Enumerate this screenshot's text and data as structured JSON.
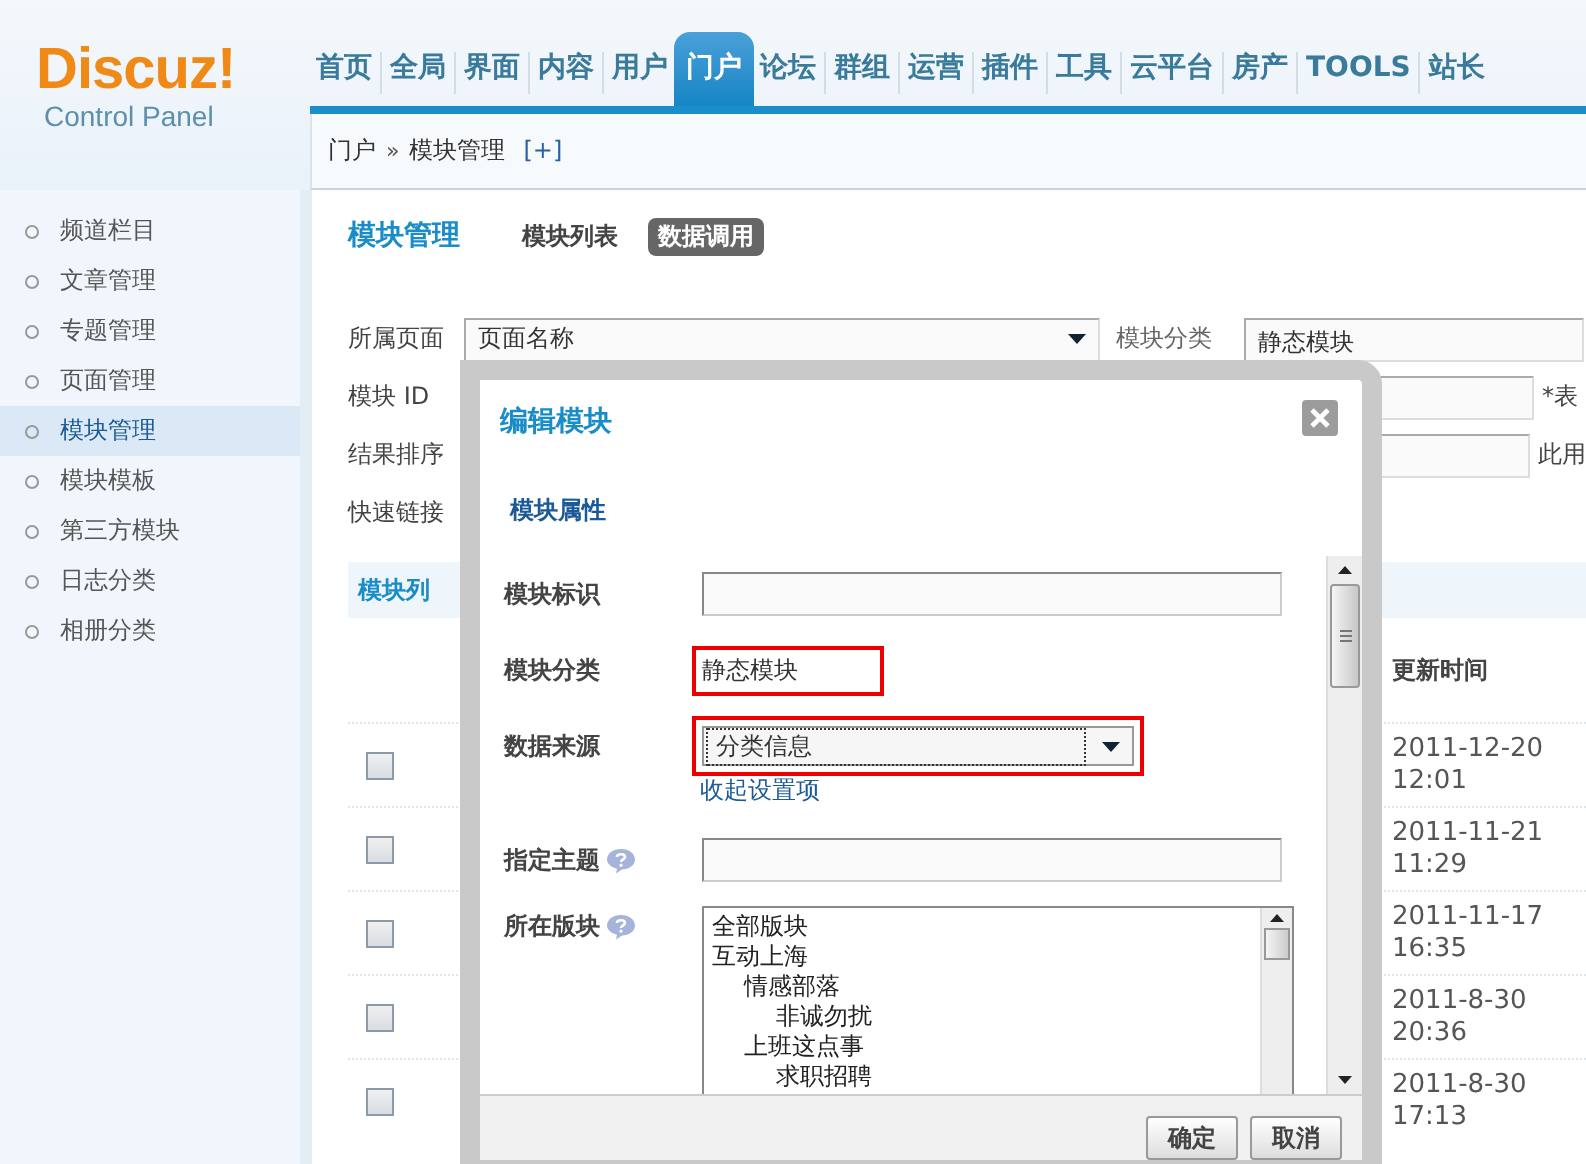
{
  "logo": {
    "name": "Discuz!",
    "subtitle": "Control Panel"
  },
  "nav": [
    {
      "label": "首页",
      "selected": false
    },
    {
      "label": "全局",
      "selected": false
    },
    {
      "label": "界面",
      "selected": false
    },
    {
      "label": "内容",
      "selected": false
    },
    {
      "label": "用户",
      "selected": false
    },
    {
      "label": "门户",
      "selected": true
    },
    {
      "label": "论坛",
      "selected": false
    },
    {
      "label": "群组",
      "selected": false
    },
    {
      "label": "运营",
      "selected": false
    },
    {
      "label": "插件",
      "selected": false
    },
    {
      "label": "工具",
      "selected": false
    },
    {
      "label": "云平台",
      "selected": false
    },
    {
      "label": "房产",
      "selected": false
    },
    {
      "label": "TOOLS",
      "selected": false
    },
    {
      "label": "站长",
      "selected": false
    }
  ],
  "breadcrumb": {
    "items": [
      "门户",
      "模块管理"
    ],
    "separator": "»",
    "add": "[+]"
  },
  "sidebar": {
    "items": [
      {
        "label": "频道栏目",
        "selected": false
      },
      {
        "label": "文章管理",
        "selected": false
      },
      {
        "label": "专题管理",
        "selected": false
      },
      {
        "label": "页面管理",
        "selected": false
      },
      {
        "label": "模块管理",
        "selected": true
      },
      {
        "label": "模块模板",
        "selected": false
      },
      {
        "label": "第三方模块",
        "selected": false
      },
      {
        "label": "日志分类",
        "selected": false
      },
      {
        "label": "相册分类",
        "selected": false
      }
    ]
  },
  "main": {
    "title": "模块管理",
    "tabs": [
      {
        "label": "模块列表",
        "selected": false
      },
      {
        "label": "数据调用",
        "selected": true
      }
    ],
    "filters": [
      {
        "label": "所属页面",
        "value": "页面名称",
        "extra_label": "模块分类",
        "extra_value": "静态模块"
      },
      {
        "label": "模块 ID",
        "note": "*表"
      },
      {
        "label": "结果排序",
        "note": "此用"
      },
      {
        "label": "快速链接"
      }
    ],
    "table": {
      "band_title": "模块列",
      "column_header": "更新时间",
      "rows": [
        {
          "checked": false,
          "updated": "2011-12-20 12:01"
        },
        {
          "checked": false,
          "updated": "2011-11-21 11:29"
        },
        {
          "checked": false,
          "updated": "2011-11-17 16:35"
        },
        {
          "checked": false,
          "updated": "2011-8-30 20:36"
        },
        {
          "checked": false,
          "updated": "2011-8-30 17:13"
        }
      ]
    }
  },
  "dialog": {
    "title": "编辑模块",
    "tab": "模块属性",
    "fields": [
      {
        "kind": "input",
        "label": "模块标识"
      },
      {
        "kind": "static",
        "label": "模块分类",
        "value": "静态模块",
        "highlighted": true
      },
      {
        "kind": "select",
        "label": "数据来源",
        "value": "分类信息",
        "highlighted": true
      },
      {
        "kind": "link",
        "label": "收起设置项"
      },
      {
        "kind": "input",
        "label": "指定主题",
        "help": true
      },
      {
        "kind": "list",
        "label": "所在版块",
        "help": true,
        "options": [
          {
            "label": "全部版块"
          },
          {
            "label": "互动上海",
            "children": [
              {
                "label": "情感部落",
                "children": [
                  {
                    "label": "非诚勿扰"
                  }
                ]
              },
              {
                "label": "上班这点事",
                "children": [
                  {
                    "label": "求职招聘"
                  }
                ]
              }
            ]
          }
        ]
      }
    ],
    "buttons": [
      "确定",
      "取消"
    ]
  }
}
